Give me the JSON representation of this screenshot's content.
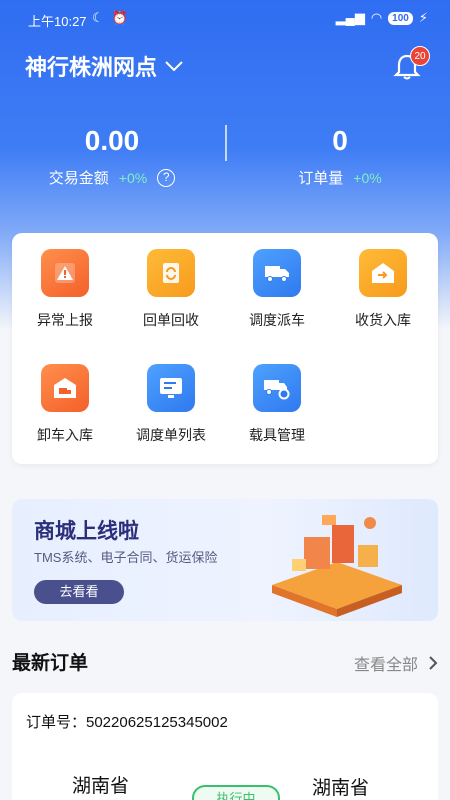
{
  "status_bar": {
    "time": "上午10:27",
    "battery": "100"
  },
  "header": {
    "title": "神行株洲网点",
    "notification_count": "20"
  },
  "stats": [
    {
      "value": "0.00",
      "label": "交易金额",
      "change": "+0%"
    },
    {
      "value": "0",
      "label": "订单量",
      "change": "+0%"
    }
  ],
  "menu": [
    {
      "label": "异常上报",
      "icon": "warning-icon",
      "color": "#f4602a"
    },
    {
      "label": "回单回收",
      "icon": "recycle-icon",
      "color": "#f79a1d"
    },
    {
      "label": "调度派车",
      "icon": "truck-icon",
      "color": "#2f79ef"
    },
    {
      "label": "收货入库",
      "icon": "warehouse-in-icon",
      "color": "#f79a1d"
    },
    {
      "label": "卸车入库",
      "icon": "unload-icon",
      "color": "#f4602a"
    },
    {
      "label": "调度单列表",
      "icon": "list-icon",
      "color": "#2f79ef"
    },
    {
      "label": "载具管理",
      "icon": "vehicle-settings-icon",
      "color": "#2f79ef"
    }
  ],
  "banner": {
    "title": "商城上线啦",
    "subtitle": "TMS系统、电子合同、货运保险",
    "button": "去看看"
  },
  "latest_orders": {
    "title": "最新订单",
    "more": "查看全部",
    "order_no": "订单号：50220625125345002",
    "from_province": "湖南省",
    "to_province": "湖南省",
    "status": "执行中"
  }
}
